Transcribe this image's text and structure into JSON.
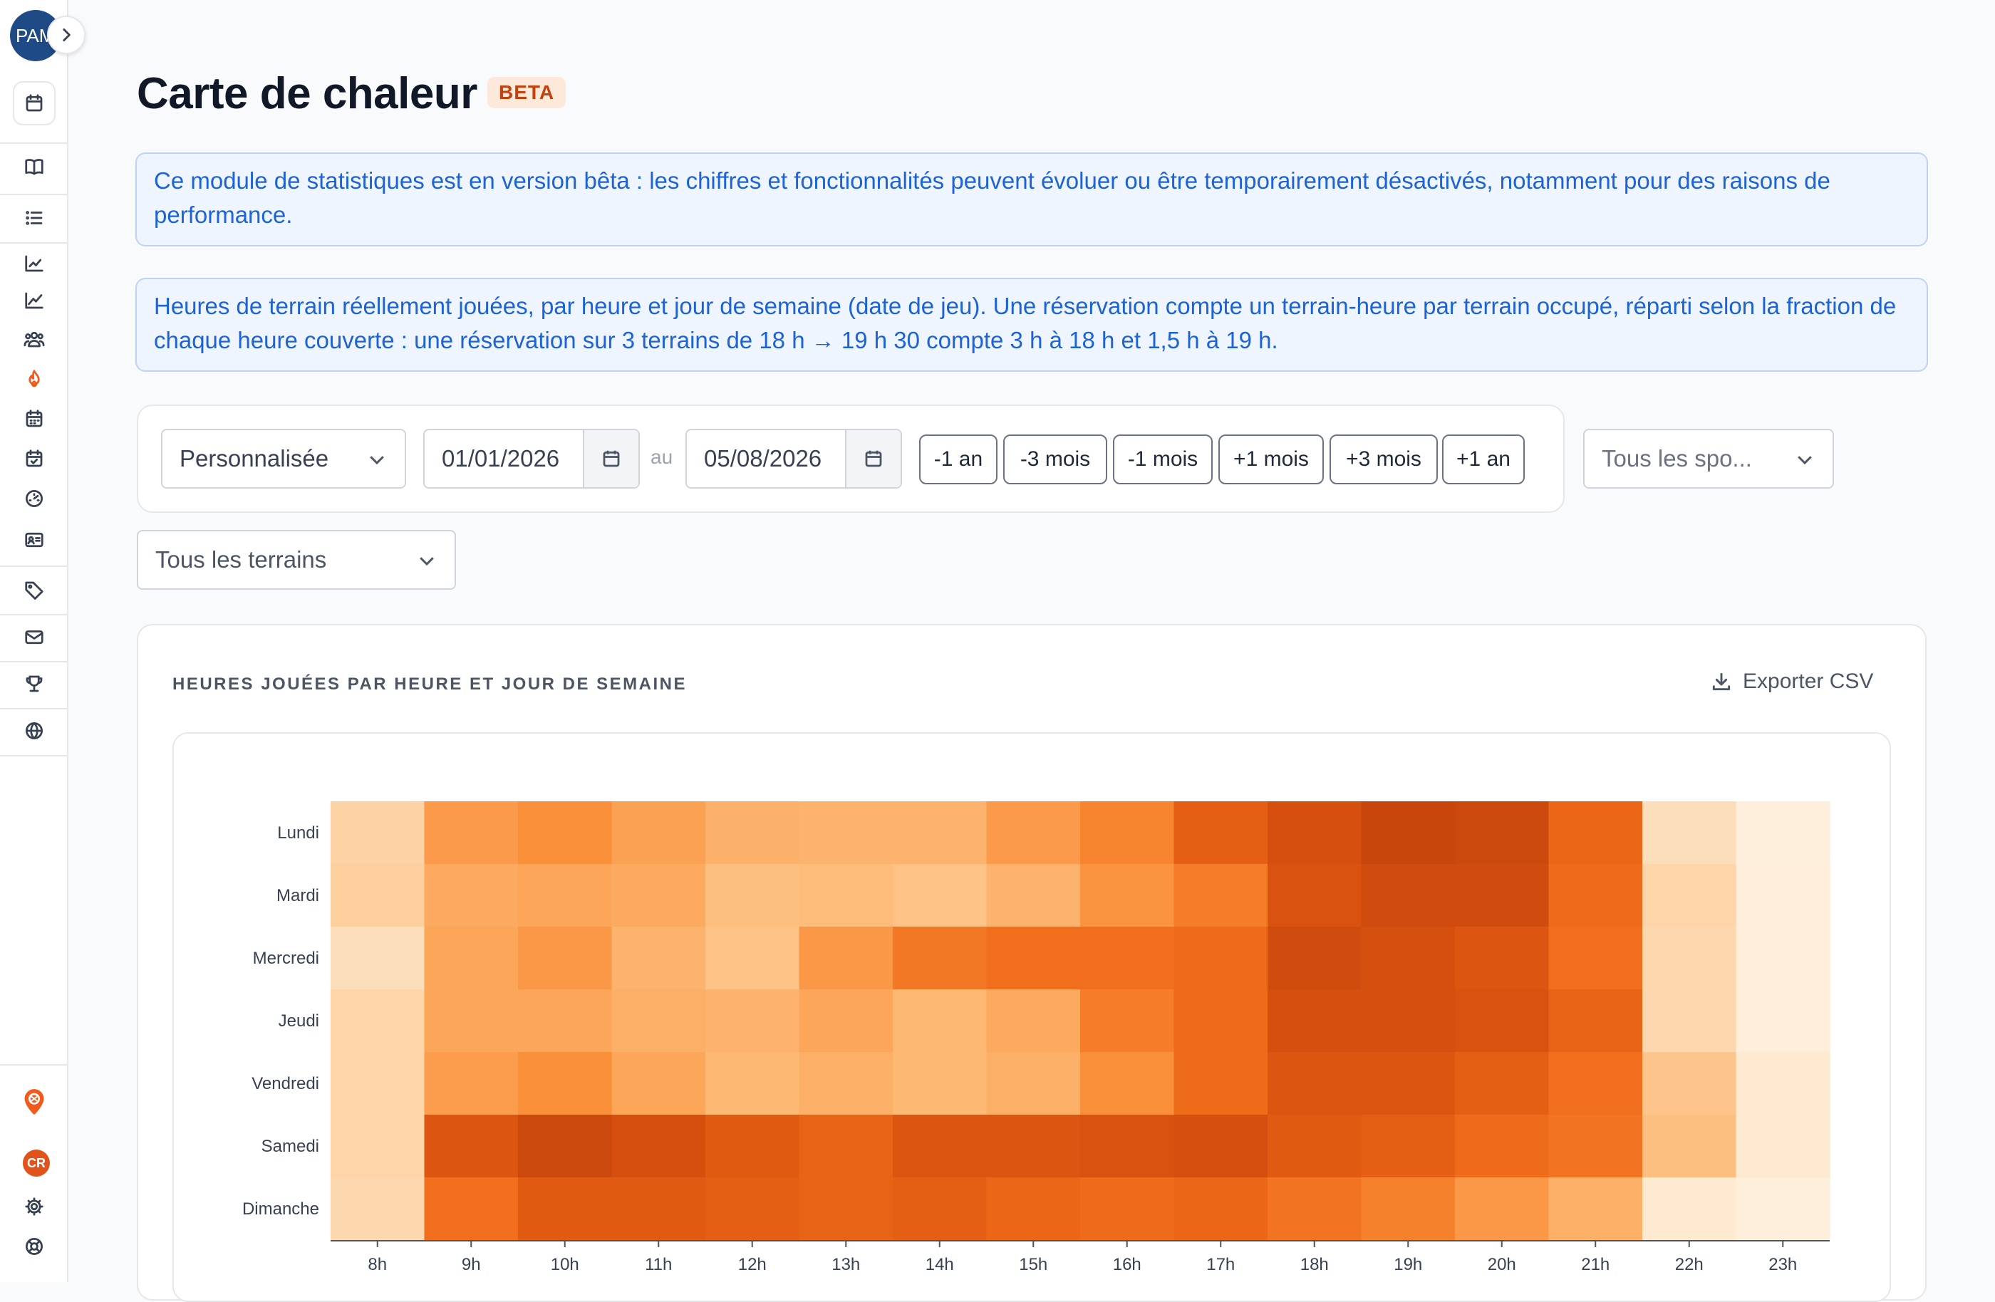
{
  "sidebar": {
    "avatar_initials": "PAM",
    "bottom_avatar_initials": "CR",
    "icons": [
      "calendar-icon",
      "book-icon",
      "list-icon",
      "chart-line-icon",
      "chart-line-up-icon",
      "users-icon",
      "fire-icon",
      "calendar-grid-icon",
      "calendar-check-icon",
      "dashboard-gauge-icon",
      "id-card-icon",
      "tag-icon",
      "mail-icon",
      "trophy-icon",
      "globe-icon",
      "location-pin-icon",
      "settings-gear-icon",
      "help-lifebuoy-icon"
    ]
  },
  "page": {
    "title": "Carte de chaleur",
    "badge": "BETA"
  },
  "notices": {
    "beta": "Ce module de statistiques est en version bêta : les chiffres et fonctionnalités peuvent évoluer ou être temporairement désactivés, notamment pour des raisons de performance.",
    "explanation": "Heures de terrain réellement jouées, par heure et jour de semaine (date de jeu). Une réservation compte un terrain-heure par terrain occupé, réparti selon la fraction de chaque heure couverte : une réservation sur 3 terrains de 18 h → 19 h 30 compte 3 h à 18 h et 1,5 h à 19 h."
  },
  "filters": {
    "period_select": "Personnalisée",
    "date_from": "01/01/2026",
    "date_separator": "au",
    "date_to": "05/08/2026",
    "shift_buttons": [
      "-1 an",
      "-3 mois",
      "-1 mois",
      "+1 mois",
      "+3 mois",
      "+1 an"
    ],
    "sport_select": "Tous les spo...",
    "court_select": "Tous les terrains"
  },
  "chart_section": {
    "heading": "HEURES JOUÉES PAR HEURE ET JOUR DE SEMAINE",
    "export_label": "Exporter CSV"
  },
  "colors": {
    "accent": "#f05a1a",
    "info_text": "#1d63d6",
    "info_bg": "#eef5ff",
    "heat_low": "#fff7ec",
    "heat_high": "#bf3f0b"
  },
  "chart_data": {
    "type": "heatmap",
    "title": "",
    "x": [
      "8h",
      "9h",
      "10h",
      "11h",
      "12h",
      "13h",
      "14h",
      "15h",
      "16h",
      "17h",
      "18h",
      "19h",
      "20h",
      "21h",
      "22h",
      "23h"
    ],
    "y": [
      "Lundi",
      "Mardi",
      "Mercredi",
      "Jeudi",
      "Vendredi",
      "Samedi",
      "Dimanche"
    ],
    "values": [
      [
        0.25,
        0.55,
        0.6,
        0.52,
        0.45,
        0.44,
        0.44,
        0.55,
        0.65,
        0.82,
        0.9,
        0.96,
        0.94,
        0.78,
        0.18,
        0.06
      ],
      [
        0.28,
        0.48,
        0.5,
        0.48,
        0.38,
        0.4,
        0.36,
        0.44,
        0.58,
        0.68,
        0.88,
        0.92,
        0.92,
        0.76,
        0.24,
        0.07
      ],
      [
        0.18,
        0.5,
        0.56,
        0.44,
        0.36,
        0.56,
        0.7,
        0.74,
        0.74,
        0.76,
        0.92,
        0.9,
        0.86,
        0.74,
        0.22,
        0.07
      ],
      [
        0.24,
        0.5,
        0.5,
        0.46,
        0.44,
        0.5,
        0.42,
        0.48,
        0.68,
        0.76,
        0.9,
        0.9,
        0.88,
        0.8,
        0.22,
        0.07
      ],
      [
        0.24,
        0.54,
        0.6,
        0.5,
        0.42,
        0.46,
        0.42,
        0.46,
        0.6,
        0.76,
        0.86,
        0.86,
        0.82,
        0.74,
        0.34,
        0.1
      ],
      [
        0.24,
        0.86,
        0.94,
        0.9,
        0.84,
        0.8,
        0.86,
        0.86,
        0.88,
        0.9,
        0.84,
        0.82,
        0.76,
        0.72,
        0.38,
        0.1
      ],
      [
        0.22,
        0.74,
        0.84,
        0.84,
        0.82,
        0.8,
        0.82,
        0.78,
        0.76,
        0.78,
        0.72,
        0.66,
        0.56,
        0.46,
        0.1,
        0.06
      ]
    ],
    "scale": "relative (0–1), no legend shown"
  }
}
